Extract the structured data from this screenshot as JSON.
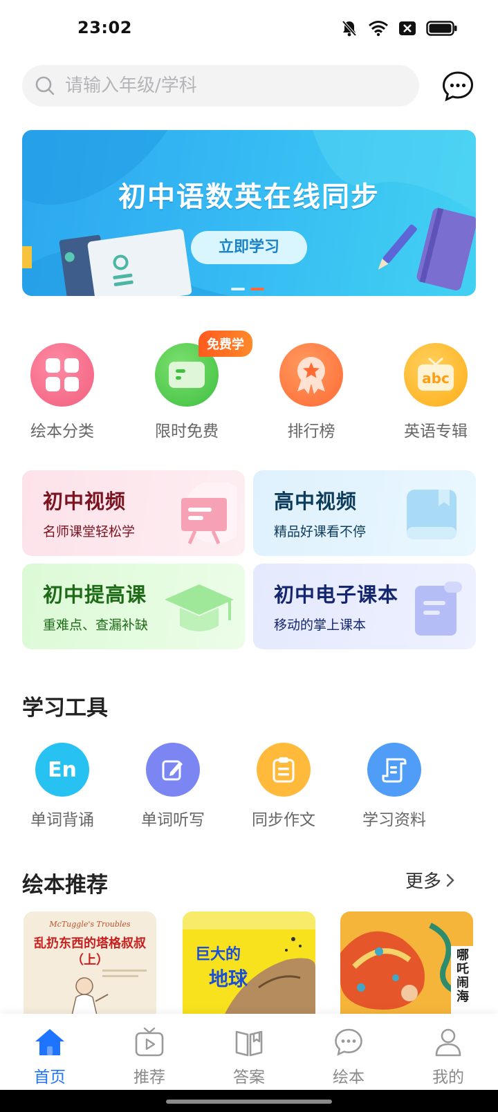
{
  "status_bar": {
    "time": "23:02"
  },
  "search": {
    "placeholder": "请输入年级/学科"
  },
  "banner": {
    "title": "初中语数英在线同步",
    "button_label": "立即学习",
    "colors": {
      "start": "#2ca7f0",
      "end": "#42d1f2"
    }
  },
  "categories": [
    {
      "label": "绘本分类",
      "icon": "grid-icon",
      "color": "#f0607f"
    },
    {
      "label": "限时免费",
      "icon": "ticket-icon",
      "color": "#48c84a",
      "badge": "免费学"
    },
    {
      "label": "排行榜",
      "icon": "award-icon",
      "color": "#ff6a35"
    },
    {
      "label": "英语专辑",
      "icon": "abc-book-icon",
      "color": "#ffb21e"
    }
  ],
  "video_cards": [
    {
      "title": "初中视频",
      "subtitle": "名师课堂轻松学",
      "title_color": "#7a1420",
      "bg": "#fde6ec"
    },
    {
      "title": "高中视频",
      "subtitle": "精品好课看不停",
      "title_color": "#0d3b5c",
      "bg": "#e2f3fd"
    },
    {
      "title": "初中提高课",
      "subtitle": "重难点、查漏补缺",
      "title_color": "#1d6b16",
      "bg": "#e3fbe0"
    },
    {
      "title": "初中电子课本",
      "subtitle": "移动的掌上课本",
      "title_color": "#14266e",
      "bg": "#e8ecfd"
    }
  ],
  "tools": {
    "title": "学习工具",
    "items": [
      {
        "label": "单词背诵",
        "icon": "en-icon",
        "glyph": "En",
        "color": "#27c2f2"
      },
      {
        "label": "单词听写",
        "icon": "edit-icon",
        "color": "#7b86f2"
      },
      {
        "label": "同步作文",
        "icon": "clipboard-icon",
        "color": "#ffba3c"
      },
      {
        "label": "学习资料",
        "icon": "document-icon",
        "color": "#4f9df7"
      }
    ]
  },
  "picture_books": {
    "title": "绘本推荐",
    "more_label": "更多",
    "books": [
      {
        "title": "乱扔东西的塔格叔叔",
        "subtitle": "（上）",
        "header": "McTuggle's Troubles"
      },
      {
        "title": "巨大的",
        "subtitle": "地球"
      },
      {
        "title": "哪吒闹海"
      }
    ]
  },
  "tab_bar": [
    {
      "label": "首页",
      "icon": "home-icon",
      "active": true
    },
    {
      "label": "推荐",
      "icon": "tv-play-icon",
      "active": false
    },
    {
      "label": "答案",
      "icon": "book-open-icon",
      "active": false
    },
    {
      "label": "绘本",
      "icon": "chat-bubble-icon",
      "active": false
    },
    {
      "label": "我的",
      "icon": "user-icon",
      "active": false
    }
  ]
}
